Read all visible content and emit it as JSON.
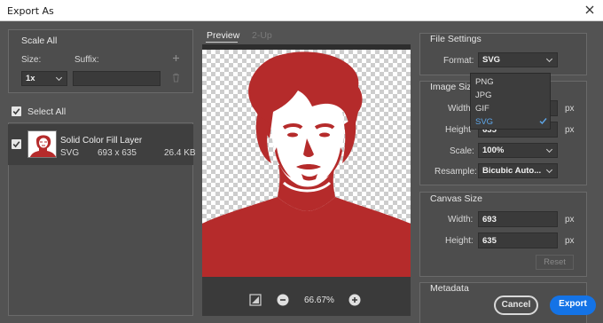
{
  "window": {
    "title": "Export As"
  },
  "left": {
    "scale_all_label": "Scale All",
    "size_label": "Size:",
    "suffix_label": "Suffix:",
    "size_value": "1x",
    "suffix_value": "",
    "select_all_label": "Select All",
    "layer": {
      "name": "Solid Color Fill Layer",
      "format": "SVG",
      "dimensions": "693 x 635",
      "filesize": "26.4 KB"
    }
  },
  "preview": {
    "tab_preview": "Preview",
    "tab_2up": "2-Up",
    "zoom": "66.67%",
    "fill_color": "#b52b2b"
  },
  "file_settings": {
    "header": "File Settings",
    "format_label": "Format:",
    "format_value": "SVG",
    "options": [
      "PNG",
      "JPG",
      "GIF",
      "SVG"
    ],
    "selected_option": "SVG"
  },
  "image_size": {
    "header": "Image Size",
    "width_label": "Width",
    "height_label": "Height",
    "width_value": "",
    "height_value": "635",
    "unit": "px",
    "scale_label": "Scale:",
    "scale_value": "100%",
    "resample_label": "Resample:",
    "resample_value": "Bicubic Auto..."
  },
  "canvas_size": {
    "header": "Canvas Size",
    "width_label": "Width:",
    "width_value": "693",
    "height_label": "Height:",
    "height_value": "635",
    "unit": "px",
    "reset_label": "Reset"
  },
  "metadata": {
    "header": "Metadata"
  },
  "buttons": {
    "cancel": "Cancel",
    "export": "Export"
  },
  "colors": {
    "accent": "#1473e6",
    "selected_option": "#5ea7ea"
  }
}
